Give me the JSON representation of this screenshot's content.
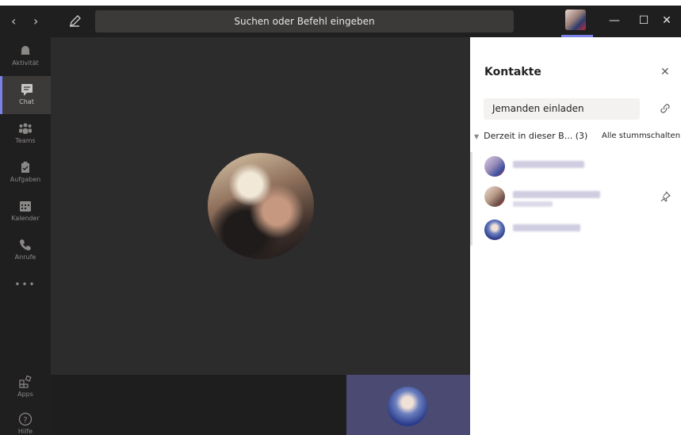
{
  "titlebar": {
    "back": "‹",
    "forward": "›",
    "search_placeholder": "Suchen oder Befehl eingeben",
    "minimize": "—",
    "maximize": "☐",
    "close": "✕"
  },
  "rail": {
    "items": [
      {
        "label": "Aktivität",
        "icon": "bell-icon"
      },
      {
        "label": "Chat",
        "icon": "chat-icon"
      },
      {
        "label": "Teams",
        "icon": "teams-icon"
      },
      {
        "label": "Aufgaben",
        "icon": "tasks-icon"
      },
      {
        "label": "Kalender",
        "icon": "calendar-icon"
      },
      {
        "label": "Anrufe",
        "icon": "phone-icon"
      }
    ],
    "more": "•••",
    "apps": "Apps",
    "help": "Hilfe",
    "active_color": "#7b83eb"
  },
  "panel": {
    "title": "Kontakte",
    "close": "✕",
    "invite_placeholder": "Jemanden einladen",
    "section_label": "Derzeit in dieser B...",
    "section_count": "(3)",
    "mute_all": "Alle stummschalten"
  }
}
